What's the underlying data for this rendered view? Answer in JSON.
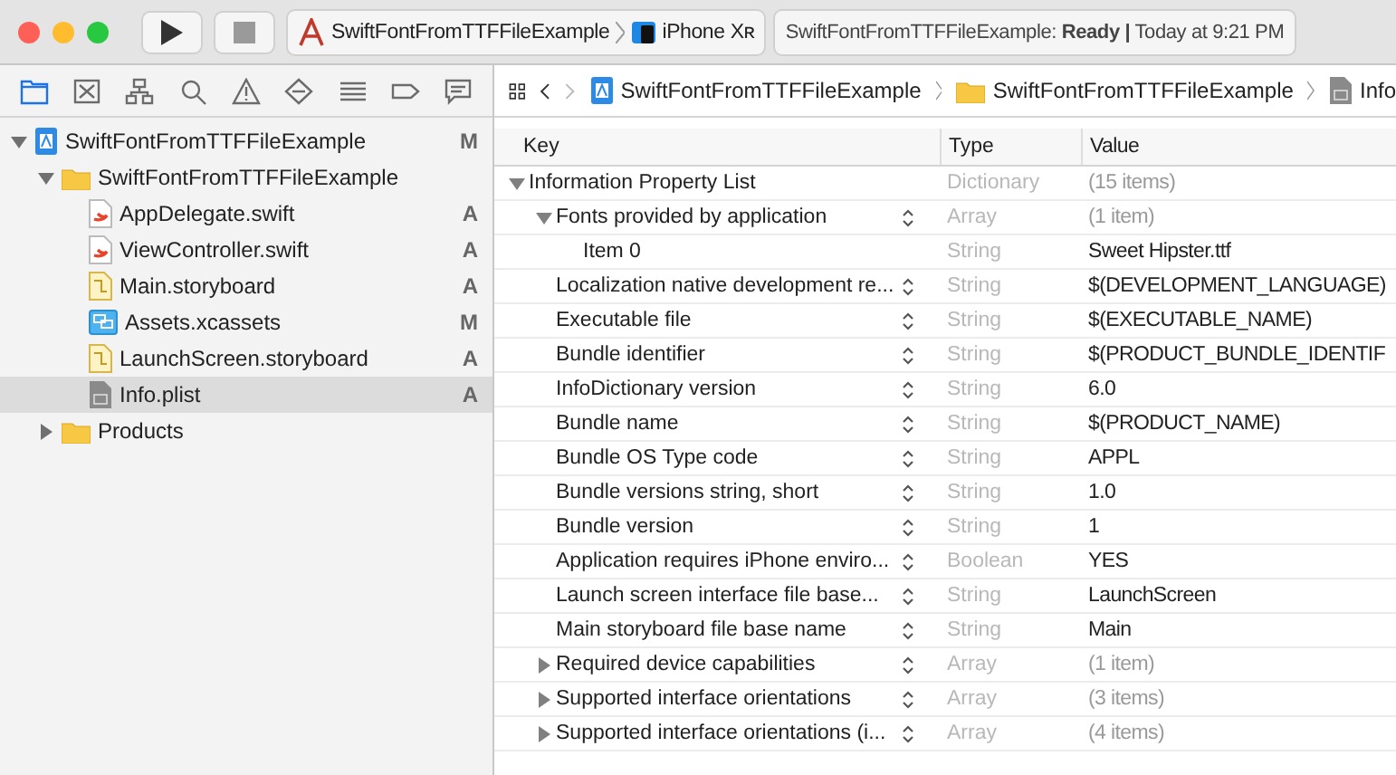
{
  "toolbar": {
    "scheme": "SwiftFontFromTTFFileExample",
    "destination": "iPhone Xʀ",
    "status": "SwiftFontFromTTFFileExample: **Ready |** Today at 9:21 PM"
  },
  "navigator_tabs": [
    {
      "selected": true
    },
    {
      "selected": false
    },
    {
      "selected": false
    },
    {
      "selected": false
    },
    {
      "selected": false
    },
    {
      "selected": false
    },
    {
      "selected": false
    },
    {
      "selected": false
    },
    {
      "selected": false
    }
  ],
  "navigator": {
    "items": [
      {
        "name": "SwiftFontFromTTFFileExample",
        "kind": "project",
        "status": "M",
        "selected": false,
        "expanded": true,
        "children": [
          {
            "name": "SwiftFontFromTTFFileExample",
            "kind": "folder",
            "selected": false,
            "expanded": true,
            "children": [
              {
                "name": "AppDelegate.swift",
                "kind": "swift",
                "status": "A",
                "selected": false
              },
              {
                "name": "ViewController.swift",
                "kind": "swift",
                "status": "A",
                "selected": false
              },
              {
                "name": "Main.storyboard",
                "kind": "storyboard",
                "status": "A",
                "selected": false
              },
              {
                "name": "Assets.xcassets",
                "kind": "assets",
                "status": "M",
                "selected": false
              },
              {
                "name": "LaunchScreen.storyboard",
                "kind": "storyboard",
                "status": "A",
                "selected": false
              },
              {
                "name": "Info.plist",
                "kind": "plist",
                "status": "A",
                "selected": true
              }
            ]
          },
          {
            "name": "Products",
            "kind": "folder",
            "selected": false,
            "expanded": false
          }
        ]
      }
    ]
  },
  "breadcrumbs": [
    {
      "label": "SwiftFontFromTTFFileExample",
      "kind": "project"
    },
    {
      "label": "SwiftFontFromTTFFileExample",
      "kind": "folder"
    },
    {
      "label": "Info",
      "kind": "plist"
    }
  ],
  "plist": {
    "columns": [
      "Key",
      "Type",
      "Value"
    ],
    "rows": [
      {
        "key": "Information Property List",
        "type": "Dictionary",
        "value": "(15 items)",
        "kind": "container",
        "stepper": false,
        "expanded": true,
        "children": [
          {
            "key": "Fonts provided by application",
            "type": "Array",
            "value": "(1 item)",
            "kind": "container",
            "stepper": true,
            "expanded": true,
            "children": [
              {
                "key": "Item 0",
                "type": "String",
                "value": "Sweet Hipster.ttf",
                "kind": "value",
                "stepper": false
              }
            ]
          },
          {
            "key": "Localization native development re...",
            "type": "String",
            "value": "$(DEVELOPMENT_LANGUAGE)",
            "kind": "value",
            "stepper": true
          },
          {
            "key": "Executable file",
            "type": "String",
            "value": "$(EXECUTABLE_NAME)",
            "kind": "value",
            "stepper": true
          },
          {
            "key": "Bundle identifier",
            "type": "String",
            "value": "$(PRODUCT_BUNDLE_IDENTIF",
            "kind": "value",
            "stepper": true
          },
          {
            "key": "InfoDictionary version",
            "type": "String",
            "value": "6.0",
            "kind": "value",
            "stepper": true
          },
          {
            "key": "Bundle name",
            "type": "String",
            "value": "$(PRODUCT_NAME)",
            "kind": "value",
            "stepper": true
          },
          {
            "key": "Bundle OS Type code",
            "type": "String",
            "value": "APPL",
            "kind": "value",
            "stepper": true
          },
          {
            "key": "Bundle versions string, short",
            "type": "String",
            "value": "1.0",
            "kind": "value",
            "stepper": true
          },
          {
            "key": "Bundle version",
            "type": "String",
            "value": "1",
            "kind": "value",
            "stepper": true
          },
          {
            "key": "Application requires iPhone enviro...",
            "type": "Boolean",
            "value": "YES",
            "kind": "value",
            "stepper": true
          },
          {
            "key": "Launch screen interface file base...",
            "type": "String",
            "value": "LaunchScreen",
            "kind": "value",
            "stepper": true
          },
          {
            "key": "Main storyboard file base name",
            "type": "String",
            "value": "Main",
            "kind": "value",
            "stepper": true
          },
          {
            "key": "Required device capabilities",
            "type": "Array",
            "value": "(1 item)",
            "kind": "container",
            "stepper": true,
            "expanded": false
          },
          {
            "key": "Supported interface orientations",
            "type": "Array",
            "value": "(3 items)",
            "kind": "container",
            "stepper": true,
            "expanded": false
          },
          {
            "key": "Supported interface orientations (i...",
            "type": "Array",
            "value": "(4 items)",
            "kind": "container",
            "stepper": true,
            "expanded": false
          }
        ]
      }
    ]
  }
}
